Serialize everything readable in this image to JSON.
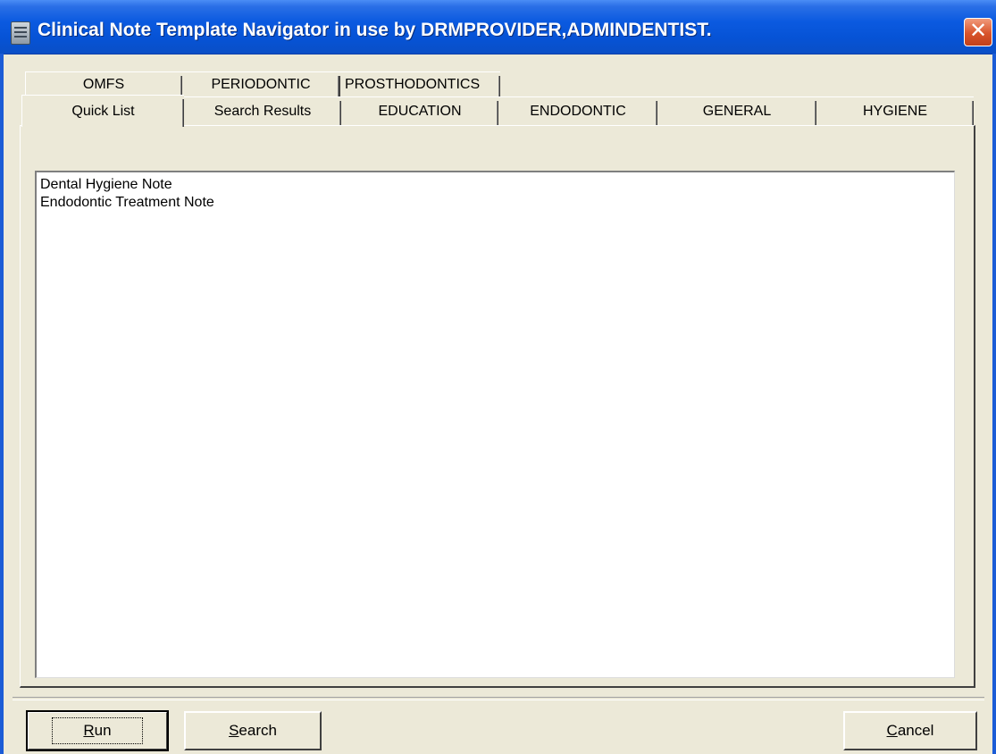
{
  "window": {
    "title": "Clinical Note Template Navigator in use by DRMPROVIDER,ADMINDENTIST.",
    "close_glyph": "✕",
    "titlebar_color": "#0653d6"
  },
  "tabs": {
    "row1": [
      {
        "label": "OMFS"
      },
      {
        "label": "PERIODONTIC"
      },
      {
        "label": "PROSTHODONTICS"
      }
    ],
    "row2": [
      {
        "label": "Quick List",
        "active": true
      },
      {
        "label": "Search Results"
      },
      {
        "label": "EDUCATION"
      },
      {
        "label": "ENDODONTIC"
      },
      {
        "label": "GENERAL"
      },
      {
        "label": "HYGIENE"
      }
    ]
  },
  "list": {
    "items": [
      "Dental Hygiene Note",
      "Endodontic Treatment Note"
    ]
  },
  "buttons": {
    "run": {
      "accel": "R",
      "rest": "un"
    },
    "search": {
      "accel": "S",
      "rest": "earch"
    },
    "cancel": {
      "accel": "C",
      "rest": "ancel"
    }
  },
  "icons": {
    "app": "clinical-note-icon",
    "close": "close-icon"
  }
}
